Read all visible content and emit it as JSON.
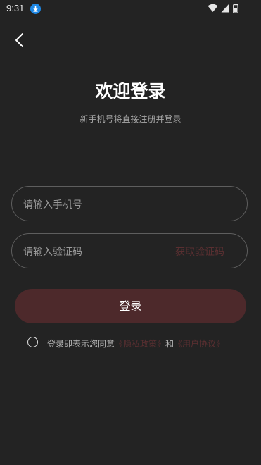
{
  "status_bar": {
    "time": "9:31",
    "icons": [
      "download-icon",
      "wifi-icon",
      "signal-icon",
      "battery-icon"
    ]
  },
  "header": {
    "back_icon": "back-arrow-icon"
  },
  "title": "欢迎登录",
  "subtitle": "新手机号将直接注册并登录",
  "phone_input": {
    "placeholder": "请输入手机号"
  },
  "code_input": {
    "placeholder": "请输入验证码",
    "get_code_label": "获取验证码"
  },
  "login_button": {
    "label": "登录"
  },
  "agreement": {
    "prefix": "登录即表示您同意",
    "privacy_link": "《隐私政策》",
    "and": "和",
    "terms_link": "《用户协议》",
    "checked": false
  },
  "colors": {
    "background": "#232323",
    "accent_dark": "#4d292b",
    "link": "#5a2f31",
    "border": "#5e5e5e"
  }
}
